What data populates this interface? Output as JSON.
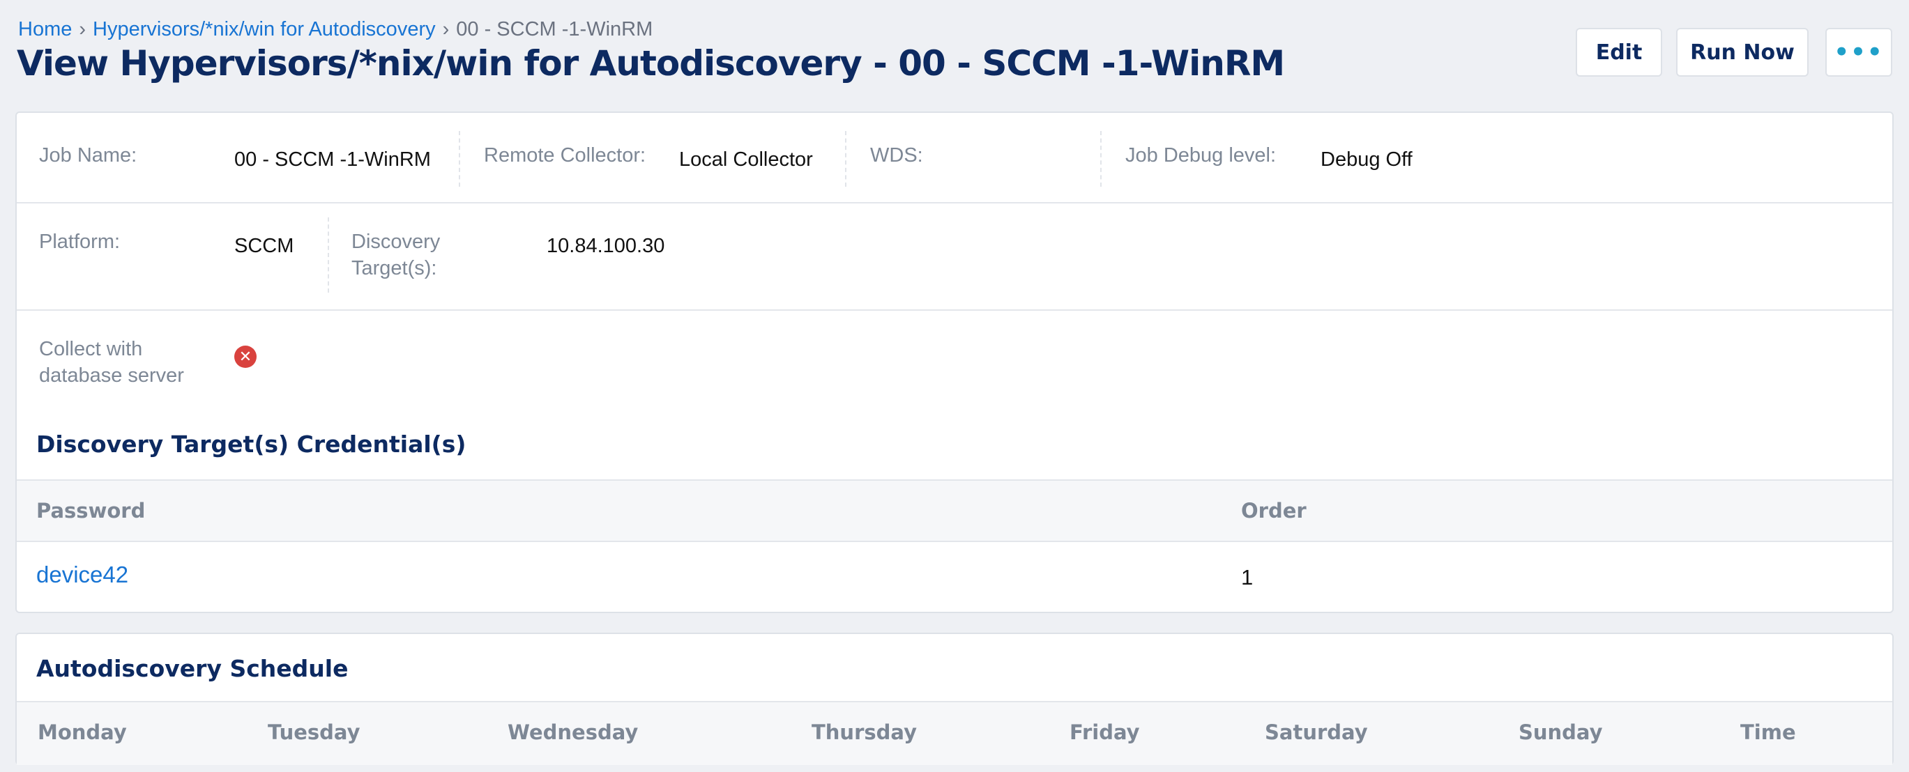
{
  "breadcrumb": {
    "home": "Home",
    "parent": "Hypervisors/*nix/win for Autodiscovery",
    "current": "00 - SCCM -1-WinRM",
    "separator": "›"
  },
  "page_title": "View Hypervisors/*nix/win for Autodiscovery - 00 - SCCM -1-WinRM",
  "actions": {
    "edit": "Edit",
    "run_now": "Run Now",
    "more": "•••"
  },
  "details": {
    "job_name_label": "Job Name:",
    "job_name": "00 - SCCM -1-WinRM",
    "remote_collector_label": "Remote Collector:",
    "remote_collector": "Local Collector",
    "wds_label": "WDS:",
    "wds": "",
    "debug_label": "Job Debug level:",
    "debug": "Debug Off",
    "platform_label": "Platform:",
    "platform": "SCCM",
    "targets_label_line1": "Discovery",
    "targets_label_line2": "Target(s):",
    "targets": "10.84.100.30",
    "collect_db_label_line1": "Collect with",
    "collect_db_label_line2": "database server",
    "collect_db_value": false,
    "collect_db_icon": "x-circle-icon",
    "collect_db_icon_color": "#d9423e"
  },
  "credentials": {
    "title": "Discovery Target(s) Credential(s)",
    "columns": [
      "Password",
      "Order"
    ],
    "rows": [
      {
        "password": "device42",
        "order": "1"
      }
    ]
  },
  "schedule": {
    "title": "Autodiscovery Schedule",
    "columns": [
      "Monday",
      "Tuesday",
      "Wednesday",
      "Thursday",
      "Friday",
      "Saturday",
      "Sunday",
      "Time"
    ]
  },
  "colors": {
    "title": "#0d2a61",
    "link": "#1874d3",
    "label": "#7d8795",
    "background": "#eef0f4"
  }
}
